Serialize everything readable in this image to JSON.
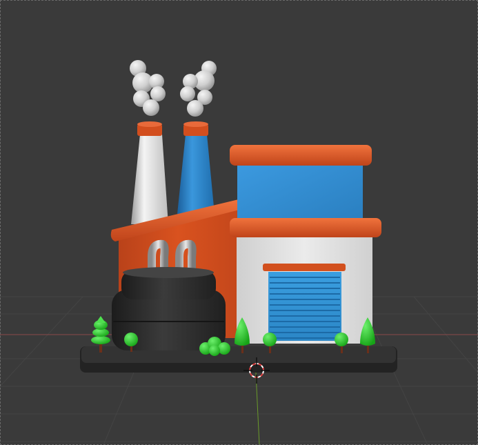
{
  "viewport": {
    "label": "3D Viewport",
    "background": "#3a3a3a",
    "grid_line_color": "#454545",
    "x_axis_color": "#8a4a4a",
    "y_axis_color": "#6a9a2a"
  },
  "scene": {
    "model": "factory",
    "colors": {
      "orange": "#d9501e",
      "blue": "#2f86c8",
      "white_wall": "#e2e2e2",
      "dark": "#2f2f2f",
      "green": "#2ecc2e",
      "trunk": "#6b2f1a",
      "smoke": "#d6d6d6"
    },
    "trees": 7,
    "chimneys": 2
  },
  "cursor": {
    "name": "3d-cursor",
    "colors": [
      "#e04040",
      "#ffffff"
    ]
  }
}
